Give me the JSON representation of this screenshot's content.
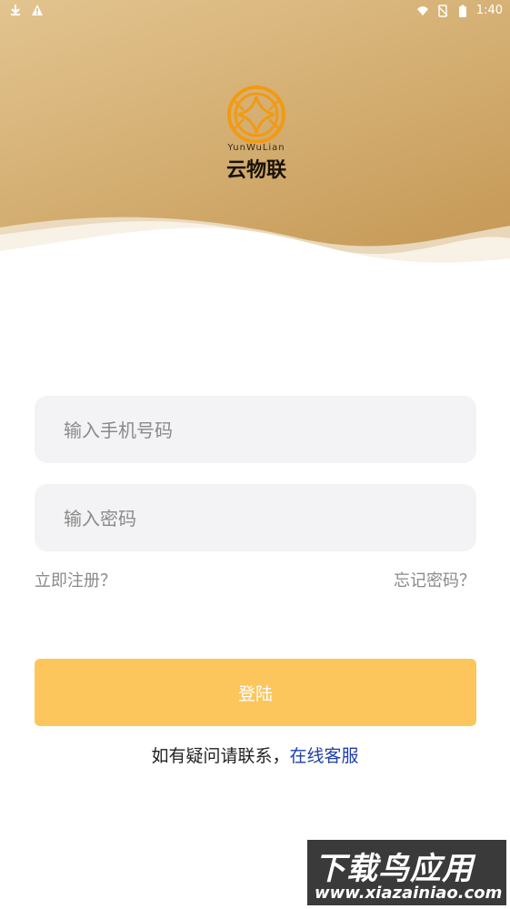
{
  "status_bar": {
    "time": "1:40",
    "icons": [
      "download-icon",
      "warning-icon",
      "wifi-icon",
      "no-sim-icon",
      "battery-icon"
    ]
  },
  "logo": {
    "brand_en": "YunWuLian",
    "brand_cn": "云物联"
  },
  "form": {
    "phone_placeholder": "输入手机号码",
    "password_placeholder": "输入密码",
    "register_link": "立即注册？",
    "forgot_link": "忘记密码？",
    "login_label": "登陆"
  },
  "help": {
    "text": "如有疑问请联系，",
    "link": "在线客服"
  },
  "watermark": {
    "title": "下载鸟应用",
    "url": "www.xiazainiao.com"
  },
  "colors": {
    "hero_gold": "#d6b277",
    "login_button": "#fcc65c",
    "link_blue": "#1f40a8",
    "field_bg": "#f3f3f5"
  }
}
